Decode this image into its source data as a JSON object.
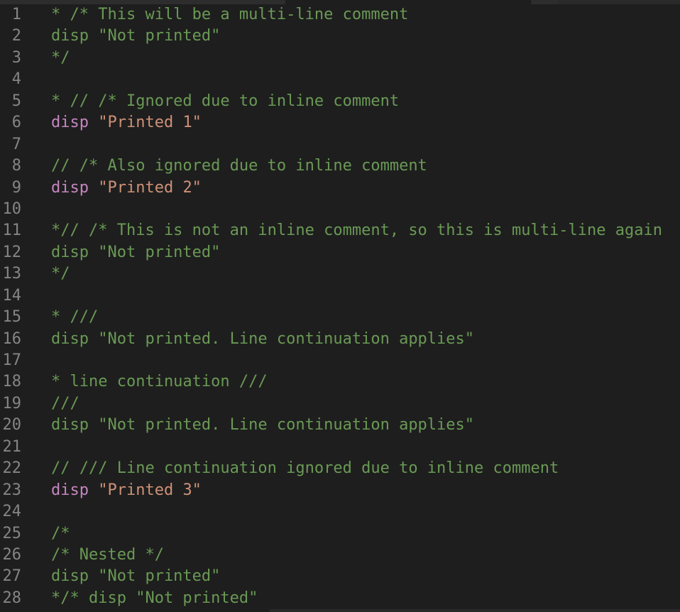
{
  "editor": {
    "lines": [
      {
        "num": "1",
        "tokens": [
          {
            "t": "comment",
            "v": "* /* This will be a multi-line comment"
          }
        ]
      },
      {
        "num": "2",
        "tokens": [
          {
            "t": "comment",
            "v": "disp \"Not printed\""
          }
        ]
      },
      {
        "num": "3",
        "tokens": [
          {
            "t": "comment",
            "v": "*/"
          }
        ]
      },
      {
        "num": "4",
        "tokens": []
      },
      {
        "num": "5",
        "tokens": [
          {
            "t": "comment",
            "v": "* // /* Ignored due to inline comment"
          }
        ]
      },
      {
        "num": "6",
        "tokens": [
          {
            "t": "keyword",
            "v": "disp"
          },
          {
            "t": "plain",
            "v": " "
          },
          {
            "t": "string",
            "v": "\"Printed 1\""
          }
        ]
      },
      {
        "num": "7",
        "tokens": []
      },
      {
        "num": "8",
        "tokens": [
          {
            "t": "comment",
            "v": "// /* Also ignored due to inline comment"
          }
        ]
      },
      {
        "num": "9",
        "tokens": [
          {
            "t": "keyword",
            "v": "disp"
          },
          {
            "t": "plain",
            "v": " "
          },
          {
            "t": "string",
            "v": "\"Printed 2\""
          }
        ]
      },
      {
        "num": "10",
        "tokens": []
      },
      {
        "num": "11",
        "tokens": [
          {
            "t": "comment",
            "v": "*// /* This is not an inline comment, so this is multi-line again"
          }
        ]
      },
      {
        "num": "12",
        "tokens": [
          {
            "t": "comment",
            "v": "disp \"Not printed\""
          }
        ]
      },
      {
        "num": "13",
        "tokens": [
          {
            "t": "comment",
            "v": "*/"
          }
        ]
      },
      {
        "num": "14",
        "tokens": []
      },
      {
        "num": "15",
        "tokens": [
          {
            "t": "comment",
            "v": "* ///"
          }
        ]
      },
      {
        "num": "16",
        "tokens": [
          {
            "t": "comment",
            "v": "disp \"Not printed. Line continuation applies\""
          }
        ]
      },
      {
        "num": "17",
        "tokens": []
      },
      {
        "num": "18",
        "tokens": [
          {
            "t": "comment",
            "v": "* line continuation ///"
          }
        ]
      },
      {
        "num": "19",
        "tokens": [
          {
            "t": "comment",
            "v": "///"
          }
        ]
      },
      {
        "num": "20",
        "tokens": [
          {
            "t": "comment",
            "v": "disp \"Not printed. Line continuation applies\""
          }
        ]
      },
      {
        "num": "21",
        "tokens": []
      },
      {
        "num": "22",
        "tokens": [
          {
            "t": "comment",
            "v": "// /// Line continuation ignored due to inline comment"
          }
        ]
      },
      {
        "num": "23",
        "tokens": [
          {
            "t": "keyword",
            "v": "disp"
          },
          {
            "t": "plain",
            "v": " "
          },
          {
            "t": "string",
            "v": "\"Printed 3\""
          }
        ]
      },
      {
        "num": "24",
        "tokens": []
      },
      {
        "num": "25",
        "tokens": [
          {
            "t": "comment",
            "v": "/*"
          }
        ]
      },
      {
        "num": "26",
        "tokens": [
          {
            "t": "comment",
            "v": "/* Nested */"
          }
        ]
      },
      {
        "num": "27",
        "tokens": [
          {
            "t": "comment",
            "v": "disp \"Not printed\""
          }
        ]
      },
      {
        "num": "28",
        "tokens": [
          {
            "t": "comment",
            "v": "*/* disp \"Not printed\""
          }
        ]
      }
    ]
  },
  "colors": {
    "background": "#1e1e1e",
    "line_number": "#858585",
    "comment": "#6a9955",
    "keyword": "#c586c0",
    "string": "#ce9178"
  }
}
